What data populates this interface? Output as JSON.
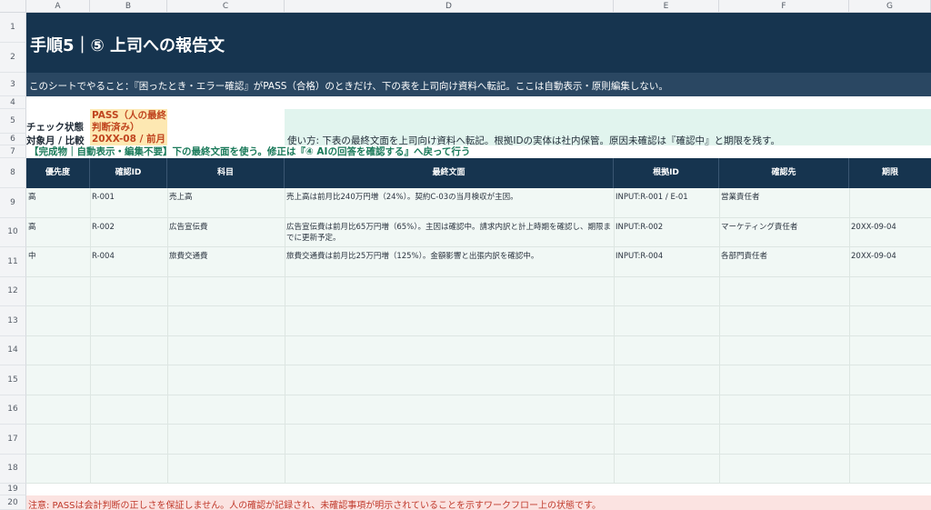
{
  "columns": [
    "A",
    "B",
    "C",
    "D",
    "E",
    "F",
    "G"
  ],
  "rows": [
    "1",
    "2",
    "3",
    "4",
    "5",
    "6",
    "7",
    "8",
    "9",
    "10",
    "11",
    "12",
    "13",
    "14",
    "15",
    "16",
    "17",
    "18",
    "19",
    "20"
  ],
  "title": "手順5｜⑤ 上司への報告文",
  "instruction": "このシートでやること：『困ったとき・エラー確認』がPASS（合格）のときだけ、下の表を上司向け資料へ転記。ここは自動表示・原則編集しない。",
  "status": {
    "check_label": "チェック状態",
    "check_value_line1": "PASS（人の最終",
    "check_value_line2": "判断済み）",
    "target_label": "対象月 / 比較",
    "target_value": "20XX-08 / 前月"
  },
  "usage": "使い方: 下表の最終文面を上司向け資料へ転記。根拠IDの実体は社内保管。原因未確認は『確認中』と期限を残す。",
  "note": "【完成物｜自動表示・編集不要】下の最終文面を使う。修正は『④ AIの回答を確認する』へ戻って行う",
  "table": {
    "headers": [
      "優先度",
      "確認ID",
      "科目",
      "最終文面",
      "根拠ID",
      "確認先",
      "期限"
    ],
    "rows": [
      {
        "priority": "高",
        "id": "R-001",
        "subject": "売上高",
        "text": "売上高は前月比240万円増（24%）。契約C-03の当月検収が主因。",
        "evidence": "INPUT:R-001 / E-01",
        "contact": "営業責任者",
        "due": ""
      },
      {
        "priority": "高",
        "id": "R-002",
        "subject": "広告宣伝費",
        "text": "広告宣伝費は前月比65万円増（65%）。主因は確認中。請求内訳と計上時期を確認し、期限までに更新予定。",
        "evidence": "INPUT:R-002",
        "contact": "マーケティング責任者",
        "due": "20XX-09-04"
      },
      {
        "priority": "中",
        "id": "R-004",
        "subject": "旅費交通費",
        "text": "旅費交通費は前月比25万円増（125%）。金額影響と出張内訳を確認中。",
        "evidence": "INPUT:R-004",
        "contact": "各部門責任者",
        "due": "20XX-09-04"
      }
    ]
  },
  "warning": "注意: PASSは会計判断の正しさを保証しません。人の確認が記録され、未確認事項が明示されていることを示すワークフロー上の状態です。"
}
